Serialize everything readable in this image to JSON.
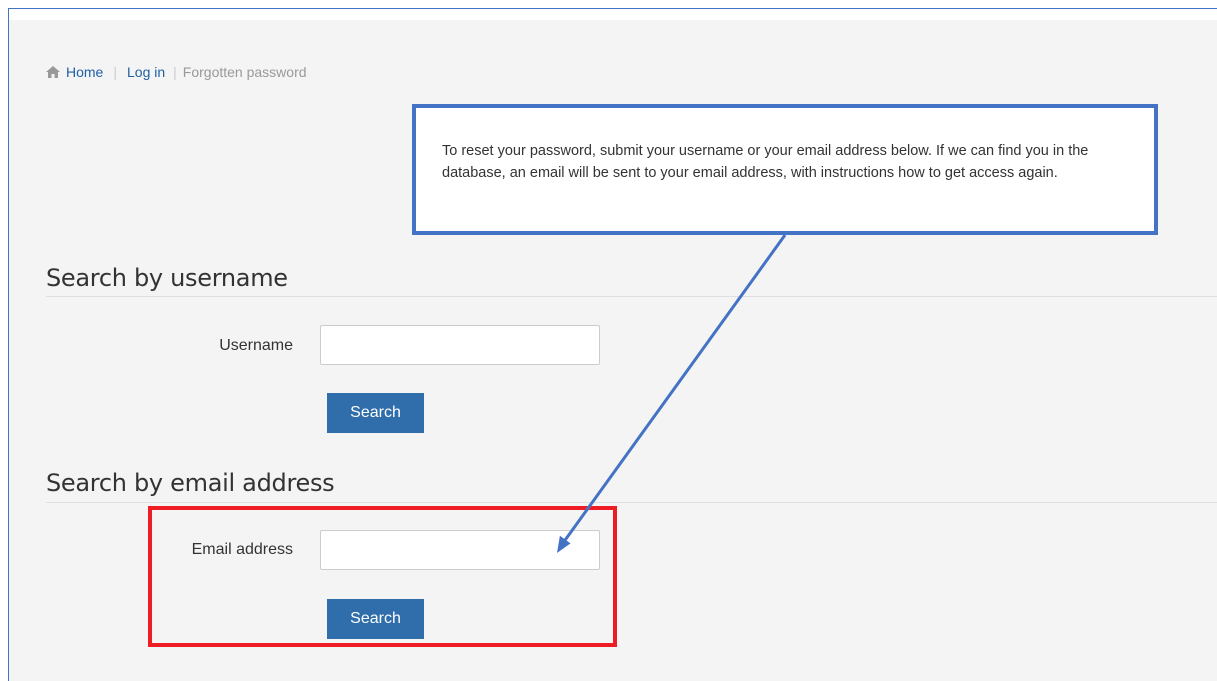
{
  "breadcrumb": {
    "home_label": "Home",
    "login_label": "Log in",
    "current_label": "Forgotten password"
  },
  "callout": {
    "text": "To reset your password, submit your username or your email address below. If we can find you in the database, an email will be sent to your email address, with instructions how to get access again."
  },
  "username_section": {
    "title": "Search by username",
    "label": "Username",
    "value": "",
    "button_label": "Search"
  },
  "email_section": {
    "title": "Search by email address",
    "label": "Email address",
    "value": "",
    "button_label": "Search"
  },
  "colors": {
    "link": "#1f5fa6",
    "button": "#2f6dab",
    "annotation_blue": "#4472c4",
    "annotation_red": "#ee1c25"
  }
}
